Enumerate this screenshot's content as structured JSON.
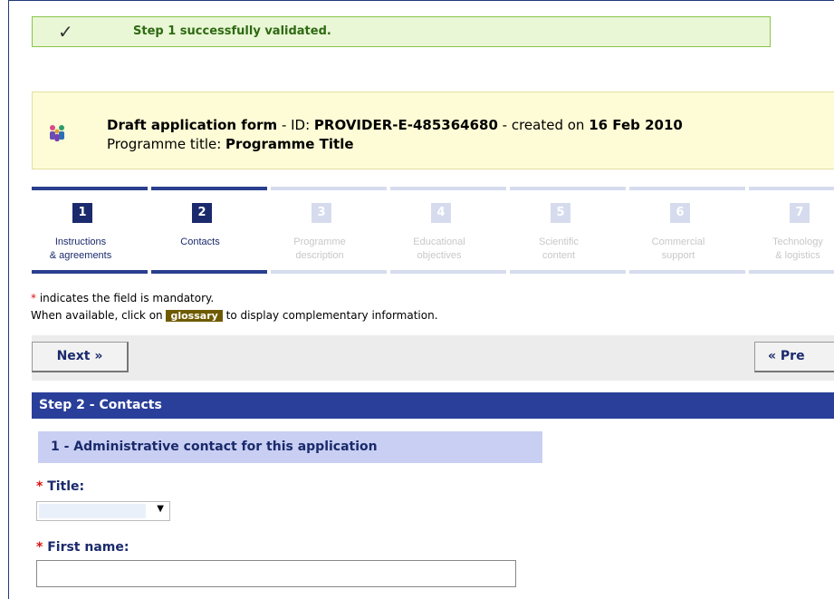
{
  "banner": {
    "icon": "checkmark-icon",
    "message": "Step 1 successfully validated."
  },
  "draft": {
    "icon": "people-group-icon",
    "title_bold": "Draft application form",
    "id_label": " - ID: ",
    "id_value": "PROVIDER-E-485364680",
    "created_label": " - created on ",
    "created_value": "16 Feb 2010",
    "programme_label": "Programme title: ",
    "programme_value": "Programme Title"
  },
  "steps": [
    {
      "num": "1",
      "line1": "Instructions",
      "line2": "& agreements",
      "state": "done"
    },
    {
      "num": "2",
      "line1": "Contacts",
      "line2": "",
      "state": "active"
    },
    {
      "num": "3",
      "line1": "Programme",
      "line2": "description",
      "state": "todo"
    },
    {
      "num": "4",
      "line1": "Educational",
      "line2": "objectives",
      "state": "todo"
    },
    {
      "num": "5",
      "line1": "Scientific",
      "line2": "content",
      "state": "todo"
    },
    {
      "num": "6",
      "line1": "Commercial",
      "line2": "support",
      "state": "todo"
    },
    {
      "num": "7",
      "line1": "Technology",
      "line2": "& logistics",
      "state": "todo"
    }
  ],
  "notes": {
    "asterisk": "*",
    "mandatory": " indicates the field is mandatory.",
    "glossary_before": "When available, click on ",
    "glossary_label": "glossary",
    "glossary_after": " to display complementary information."
  },
  "actions": {
    "next": "Next »",
    "prev": "« Pre"
  },
  "section": {
    "title": "Step 2 - Contacts",
    "subsection": "1 - Administrative contact for this application"
  },
  "form": {
    "title_label": "Title:",
    "title_value": "",
    "first_name_label": "First name:",
    "first_name_value": ""
  },
  "colors": {
    "accent": "#2a3f9a",
    "success_bg": "#eaf7d6",
    "draft_bg": "#fdfcd6",
    "required": "#dd1111"
  }
}
